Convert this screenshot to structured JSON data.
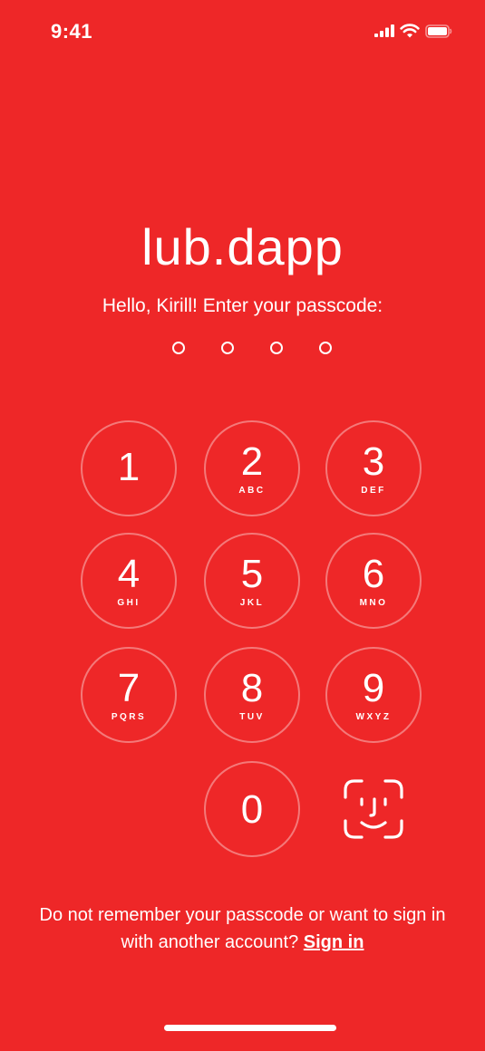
{
  "status_bar": {
    "time": "9:41",
    "icons": [
      "signal-icon",
      "wifi-icon",
      "battery-icon"
    ]
  },
  "app": {
    "title": "lub.dapp",
    "prompt": "Hello, Kirill! Enter your passcode:",
    "passcode_length": 4,
    "entered_digits": 0
  },
  "keypad": {
    "keys": [
      {
        "digit": "1",
        "letters": ""
      },
      {
        "digit": "2",
        "letters": "ABC"
      },
      {
        "digit": "3",
        "letters": "DEF"
      },
      {
        "digit": "4",
        "letters": "GHI"
      },
      {
        "digit": "5",
        "letters": "JKL"
      },
      {
        "digit": "6",
        "letters": "MNO"
      },
      {
        "digit": "7",
        "letters": "PQRS"
      },
      {
        "digit": "8",
        "letters": "TUV"
      },
      {
        "digit": "9",
        "letters": "WXYZ"
      },
      {
        "digit": "0",
        "letters": ""
      }
    ],
    "biometric_icon": "face-id-icon"
  },
  "footer": {
    "text": "Do not remember your passcode or want to sign in with another account?",
    "link_label": "Sign in"
  },
  "colors": {
    "background": "#ee2728",
    "foreground": "#ffffff"
  }
}
